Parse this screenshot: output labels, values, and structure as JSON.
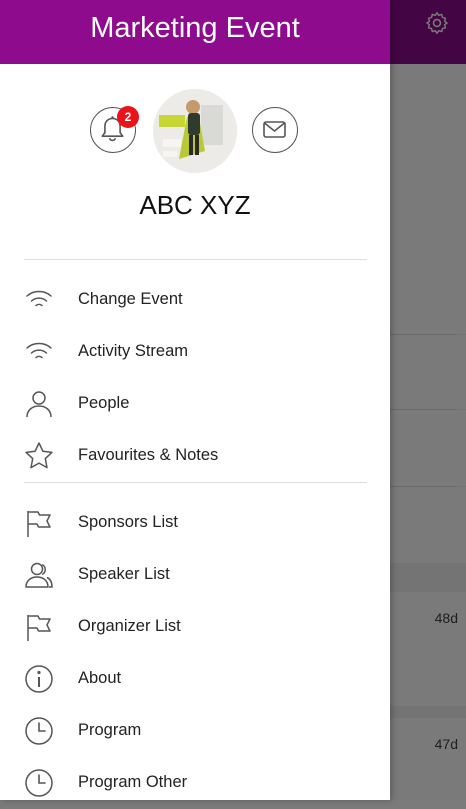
{
  "app": {
    "title": "Marketing Event",
    "user_name": "ABC XYZ",
    "notification_count": "2"
  },
  "header_icons": {
    "settings": "gear-icon",
    "notifications": "bell-icon",
    "messages": "mail-icon"
  },
  "menu": {
    "items": [
      {
        "label": "Change Event",
        "icon": "wifi-icon"
      },
      {
        "label": "Activity Stream",
        "icon": "wifi-icon"
      },
      {
        "label": "People",
        "icon": "person-icon"
      },
      {
        "label": "Favourites & Notes",
        "icon": "star-icon"
      },
      {
        "label": "Sponsors List",
        "icon": "flag-icon"
      },
      {
        "label": "Speaker List",
        "icon": "people-icon"
      },
      {
        "label": "Organizer List",
        "icon": "flag-icon"
      },
      {
        "label": "About",
        "icon": "info-icon"
      },
      {
        "label": "Program",
        "icon": "clock-icon"
      },
      {
        "label": "Program Other",
        "icon": "clock-icon"
      }
    ]
  },
  "background_feed": {
    "items": [
      {
        "age": "48d"
      },
      {
        "age": "47d"
      }
    ]
  },
  "colors": {
    "brand": "#8e0b8e",
    "badge": "#e8141a"
  }
}
